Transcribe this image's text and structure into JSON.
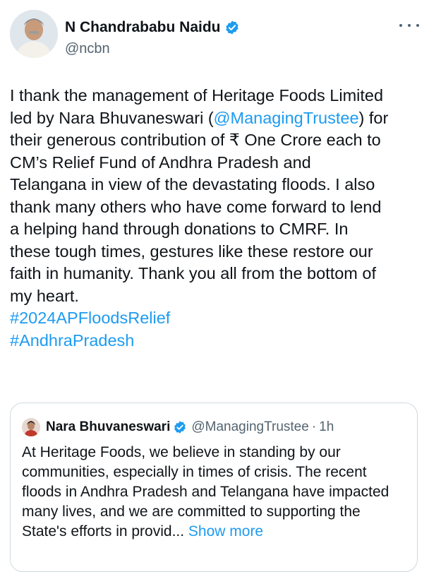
{
  "author": {
    "name": "N Chandrababu Naidu",
    "handle": "@ncbn",
    "verified_color": "#1d9bf0"
  },
  "more_icon": "more-horizontal-icon",
  "tweet": {
    "line1": "I thank the management of Heritage Foods Limited",
    "line2_prefix": "led by Nara Bhuvaneswari (",
    "mention": "@ManagingTrustee",
    "line2_suffix": ") for",
    "line3": "their generous contribution of ₹ One Crore each to",
    "line4": "CM’s Relief Fund of Andhra Pradesh and",
    "line5": "Telangana in view of the devastating floods. I also",
    "line6": "thank many others who have come forward to lend",
    "line7": "a helping hand through donations to CMRF. In",
    "line8": "these tough times, gestures like these restore our",
    "line9": "faith in humanity. Thank you all from the bottom of",
    "line10": "my heart.",
    "hashtags": [
      "#2024APFloodsRelief",
      "#AndhraPradesh"
    ]
  },
  "quote": {
    "name": "Nara Bhuvaneswari",
    "handle": "@ManagingTrustee",
    "separator": "·",
    "time": "1h",
    "text": "At Heritage Foods, we believe in standing by our communities, especially in times of crisis. The recent floods in Andhra Pradesh and Telangana have impacted many lives, and we are committed to supporting the State's efforts in provid... ",
    "show_more": "Show more"
  },
  "colors": {
    "text": "#0f1419",
    "secondary": "#536471",
    "link": "#1d9bf0",
    "border": "#cfd9de"
  }
}
